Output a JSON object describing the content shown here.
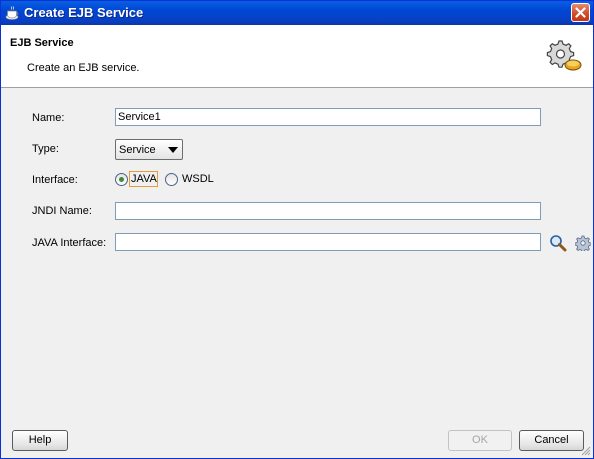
{
  "window": {
    "title": "Create EJB Service"
  },
  "header": {
    "title": "EJB Service",
    "subtitle": "Create an EJB service."
  },
  "form": {
    "name_label": "Name:",
    "name_value": "Service1",
    "type_label": "Type:",
    "type_value": "Service",
    "interface_label": "Interface:",
    "interface_options": [
      "JAVA",
      "WSDL"
    ],
    "interface_selected": "JAVA",
    "jndi_label": "JNDI Name:",
    "jndi_value": "",
    "java_interface_label": "JAVA Interface:",
    "java_interface_value": ""
  },
  "buttons": {
    "help": "Help",
    "ok": "OK",
    "cancel": "Cancel"
  },
  "icons": {
    "title_icon": "coffee-cup-icon",
    "header_icon": "gears-icon",
    "search_icon": "magnifier-icon",
    "settings_icon": "gear-icon",
    "close_icon": "close-icon"
  },
  "colors": {
    "titlebar": "#0046d5",
    "close": "#cf4a26",
    "focus": "#e39e3c"
  }
}
